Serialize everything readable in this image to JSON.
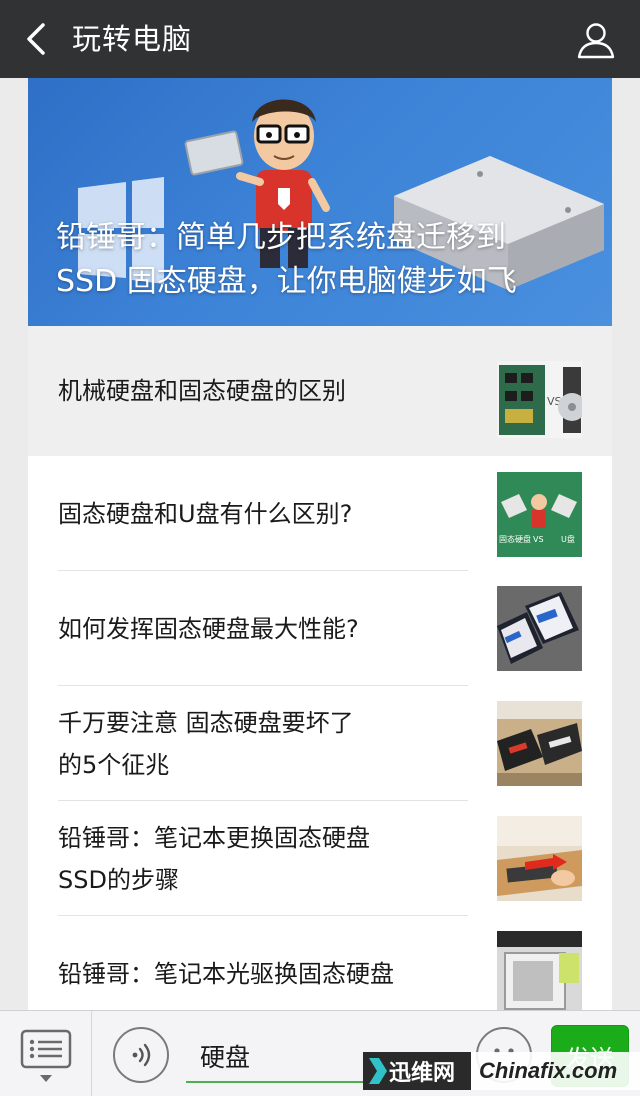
{
  "header": {
    "title": "玩转电脑"
  },
  "hero": {
    "title_line1": "铅锤哥：简单几步把系统盘迁移到",
    "title_line2": "SSD 固态硬盘，让你电脑健步如飞"
  },
  "articles": [
    {
      "title": "机械硬盘和固态硬盘的区别",
      "thumb_icon": "ssd-vs-hdd-thumbnail"
    },
    {
      "title": "固态硬盘和U盘有什么区别?",
      "thumb_icon": "ssd-vs-usb-thumbnail"
    },
    {
      "title": "如何发挥固态硬盘最大性能?",
      "thumb_icon": "ssd-drives-thumbnail"
    },
    {
      "title_line1": "千万要注意 固态硬盘要坏了",
      "title_line2": "的5个征兆",
      "thumb_icon": "ssd-boxes-thumbnail"
    },
    {
      "title_line1": "铅锤哥：笔记本更换固态硬盘",
      "title_line2": "SSD的步骤",
      "thumb_icon": "laptop-ssd-install-thumbnail"
    },
    {
      "title": "铅锤哥：笔记本光驱换固态硬盘",
      "thumb_icon": "optical-bay-caddy-thumbnail"
    }
  ],
  "input_bar": {
    "input_value": "硬盘",
    "send_label": "发送"
  },
  "watermark": {
    "left_text": "迅维网",
    "right_text": "Chinafix.com"
  },
  "colors": {
    "topbar": "#313233",
    "send_button": "#1aad19",
    "input_underline": "#4caf50"
  }
}
